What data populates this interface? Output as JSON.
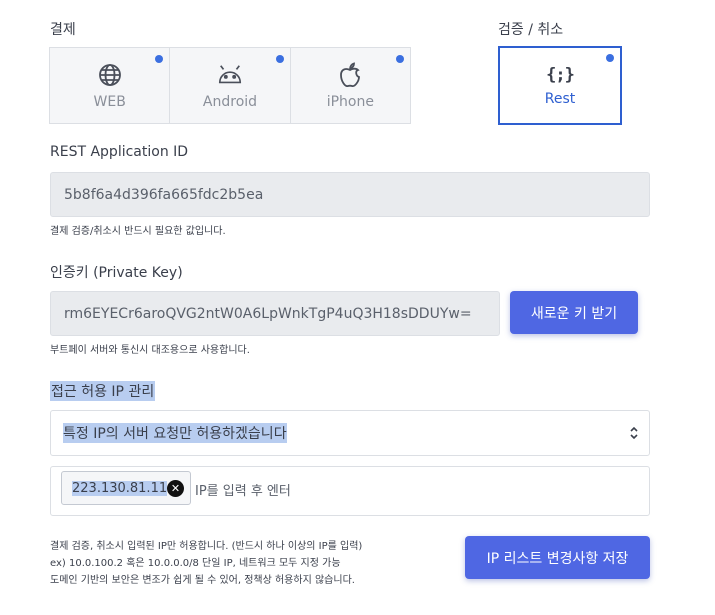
{
  "payment": {
    "title": "결제",
    "platforms": [
      {
        "label": "WEB",
        "icon": "globe-icon"
      },
      {
        "label": "Android",
        "icon": "android-icon"
      },
      {
        "label": "iPhone",
        "icon": "apple-icon"
      }
    ]
  },
  "verify": {
    "title": "검증 / 취소",
    "rest_label": "Rest",
    "rest_icon": "curly-braces-icon"
  },
  "rest_app_id": {
    "label": "REST Application ID",
    "value": "5b8f6a4d396fa665fdc2b5ea",
    "helper": "결제 검증/취소시 반드시 필요한 값입니다."
  },
  "private_key": {
    "label": "인증키 (Private Key)",
    "value": "rm6EYECr6aroQVG2ntW0A6LpWnkTgP4uQ3H18sDDUYw=",
    "new_key_button": "새로운 키 받기",
    "helper": "부트페이 서버와 통신시 대조용으로 사용합니다."
  },
  "ip_access": {
    "title": "접근 허용 IP 관리",
    "select_value": "특정 IP의 서버 요청만 허용하겠습니다",
    "tags": [
      "223.130.81.11"
    ],
    "input_placeholder": "IP를 입력 후 엔터",
    "notes": [
      "결제 검증, 취소시 입력된 IP만 허용합니다. (반드시 하나 이상의 IP를 입력)",
      "ex) 10.0.100.2 혹은 10.0.0.0/8 단일 IP, 네트워크 모두 지정 가능",
      "도메인 기반의 보안은 변조가 쉽게 될 수 있어, 정책상 허용하지 않습니다."
    ],
    "save_button": "IP 리스트 변경사항 저장"
  },
  "colors": {
    "accent": "#4f67e3",
    "selected_border": "#2e5fd0",
    "dot": "#3b6fe0",
    "highlight": "#b8cdf0"
  }
}
